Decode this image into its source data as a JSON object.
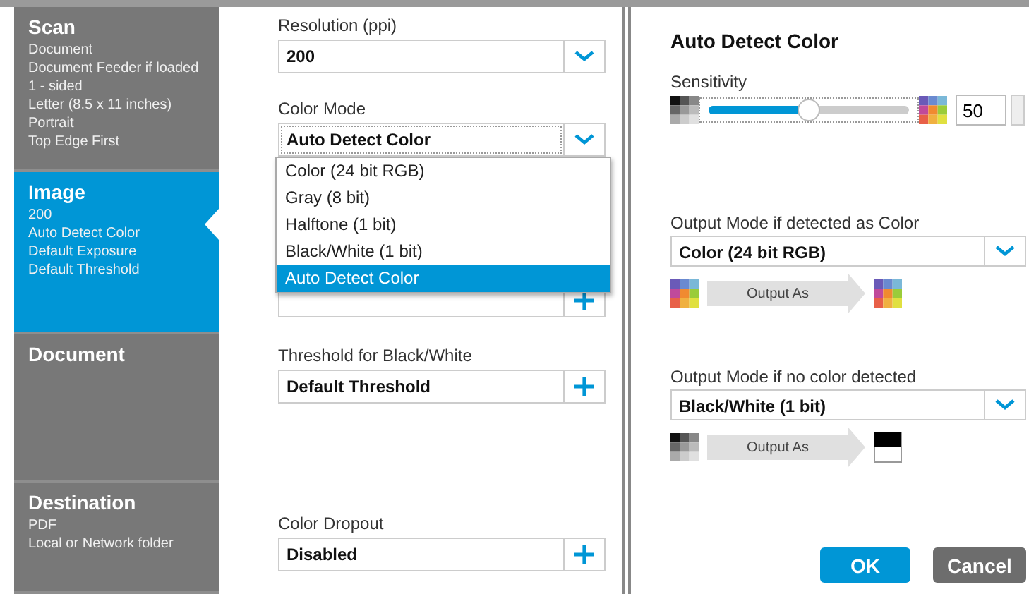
{
  "sidebar": {
    "items": [
      {
        "title": "Scan",
        "lines": [
          "Document",
          "Document Feeder if loaded",
          "1 - sided",
          "Letter (8.5 x 11 inches)",
          "Portrait",
          "Top Edge First"
        ],
        "selected": false
      },
      {
        "title": "Image",
        "lines": [
          "200",
          "Auto Detect Color",
          "Default Exposure",
          "Default Threshold"
        ],
        "selected": true
      },
      {
        "title": "Document",
        "selected": false
      },
      {
        "title": "Destination",
        "lines": [
          "PDF",
          "Local or Network folder"
        ],
        "selected": false
      }
    ]
  },
  "settings": {
    "resolution": {
      "label": "Resolution (ppi)",
      "value": "200",
      "kind": "select"
    },
    "color_mode": {
      "label": "Color Mode",
      "value": "Auto Detect Color",
      "kind": "select",
      "expanded": true,
      "options": [
        {
          "label": "Color (24 bit RGB)",
          "selected": false
        },
        {
          "label": "Gray (8 bit)",
          "selected": false
        },
        {
          "label": "Halftone (1 bit)",
          "selected": false
        },
        {
          "label": "Black/White (1 bit)",
          "selected": false
        },
        {
          "label": "Auto Detect Color",
          "selected": true
        }
      ]
    },
    "threshold": {
      "label": "Threshold for Black/White",
      "value": "Default Threshold",
      "kind": "plus"
    },
    "color_dropout": {
      "label": "Color Dropout",
      "value": "Disabled",
      "kind": "plus"
    }
  },
  "dialog": {
    "title": "Auto Detect Color",
    "sensitivity": {
      "label": "Sensitivity",
      "level": 0.5,
      "value": "50"
    },
    "outputs": [
      {
        "label": "Output Mode if detected as Color",
        "value": "Color (24 bit RGB)",
        "arrow": "Output As",
        "kind": "color"
      },
      {
        "label": "Output Mode if no color detected",
        "value": "Black/White (1 bit)",
        "arrow": "Output As",
        "kind": "bw"
      }
    ],
    "buttons": [
      {
        "label": "OK",
        "kind": "primary"
      },
      {
        "label": "Cancel",
        "kind": "secondary"
      }
    ]
  }
}
